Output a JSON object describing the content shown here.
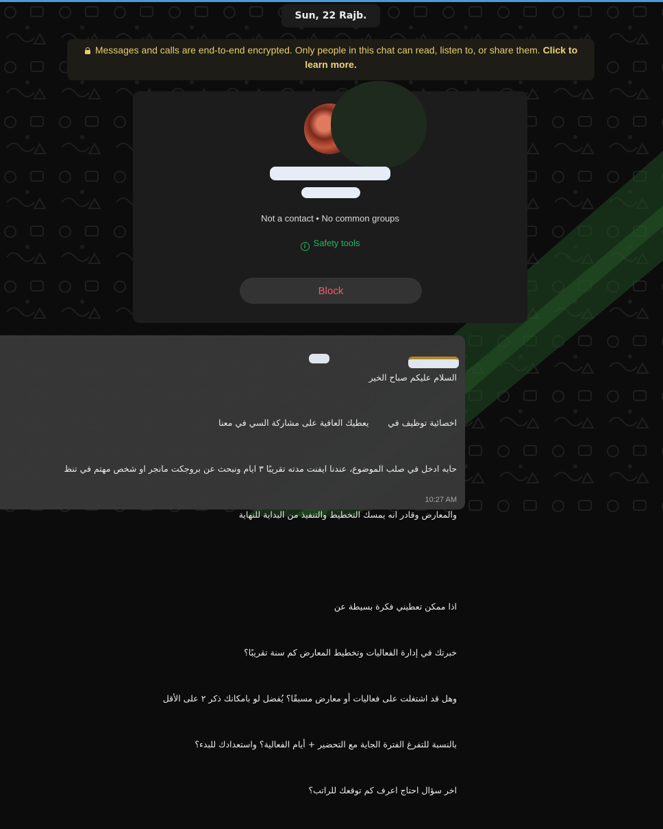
{
  "date": "Sun, 22 Rajb.",
  "encryption": {
    "text": "Messages and calls are end-to-end encrypted. Only people in this chat can read, listen to, or share them.",
    "link": "Click to learn more."
  },
  "contact_card": {
    "status": "Not a contact • No common groups",
    "safety_tools": "Safety tools",
    "block_label": "Block"
  },
  "message": {
    "lines": [
      "السلام عليكم صباح الخير",
      "اخصائية توظيف في       يعطيك العافية على مشاركة السي في معنا",
      "حابه ادخل في صلب الموضوع، عندنا ايفنت مدته تقريبًا ٣ ايام ونبحث عن بروجكت مانجر او شخص مهتم في تنظ",
      "والمعارض وقادر انه يمسك التخطيط والتنفيذ من البداية للنهاية",
      "",
      "اذا ممكن تعطيني فكرة بسيطة عن",
      "خبرتك في إدارة الفعاليات وتخطيط المعارض كم سنة تقريبًا؟",
      "وهل قد اشتغلت على فعاليات أو معارض مسبقًا؟ يُفضل لو بامكانك ذكر ٢ على الأقل",
      "بالنسبة للتفرغ الفترة الجاية مع التحضير + أيام الفعالية؟ واستعدادك للبدء؟",
      "اخر سؤال احتاج اعرف كم توقعك للراتب؟"
    ],
    "time": "10:27 AM"
  },
  "colors": {
    "accent_green": "#25b65c",
    "block_red": "#f15c6d",
    "encryption_yellow": "#e8cd6b"
  }
}
